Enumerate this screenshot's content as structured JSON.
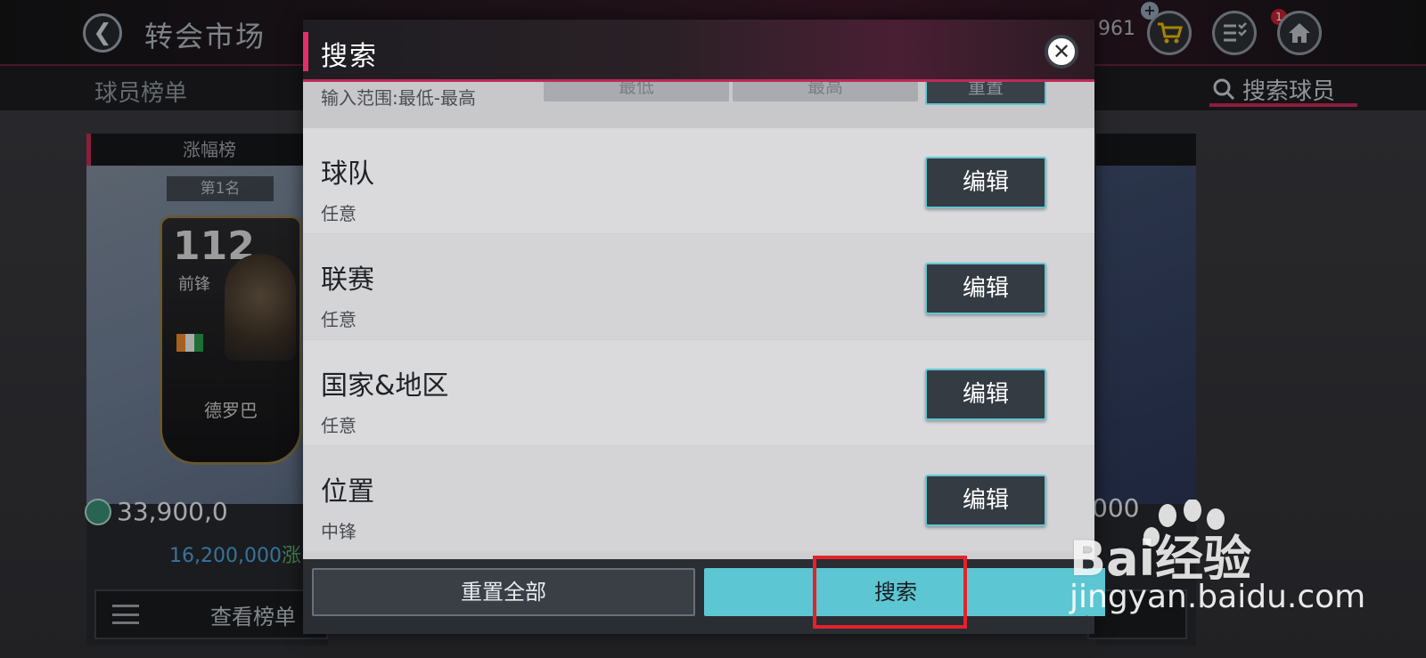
{
  "header": {
    "title": "转会市场",
    "coins_partial": "961",
    "notification_count": "1",
    "icons": [
      "back-arrow-icon",
      "cart-icon",
      "tasks-icon",
      "home-icon"
    ]
  },
  "subnav": {
    "left_tab": "球员榜单",
    "right_tab": "搜索球员"
  },
  "left_card": {
    "title": "涨幅榜",
    "rank": "第1名",
    "player": {
      "rating": "112",
      "position": "前锋",
      "name": "德罗巴"
    },
    "price": "33,900,0",
    "sub_price": "16,200,000",
    "sub_price_tail": "涨",
    "view_button": "查看榜单"
  },
  "right_card": {
    "price": "000"
  },
  "modal": {
    "title": "搜索",
    "range": {
      "label": "输入范围:最低-最高",
      "min_placeholder": "最低",
      "max_placeholder": "最高",
      "reset_label": "重置"
    },
    "filters": [
      {
        "name": "球队",
        "value": "任意",
        "button": "编辑"
      },
      {
        "name": "联赛",
        "value": "任意",
        "button": "编辑"
      },
      {
        "name": "国家&地区",
        "value": "任意",
        "button": "编辑"
      },
      {
        "name": "位置",
        "value": "中锋",
        "button": "编辑"
      }
    ],
    "footer": {
      "reset_all": "重置全部",
      "search": "搜索"
    }
  },
  "watermark": {
    "brand": "Bai经验",
    "url": "jingyan.baidu.com"
  },
  "colors": {
    "accent_pink": "#c02a55",
    "cyan": "#5cc7d3",
    "highlight_red": "#e4222b"
  }
}
